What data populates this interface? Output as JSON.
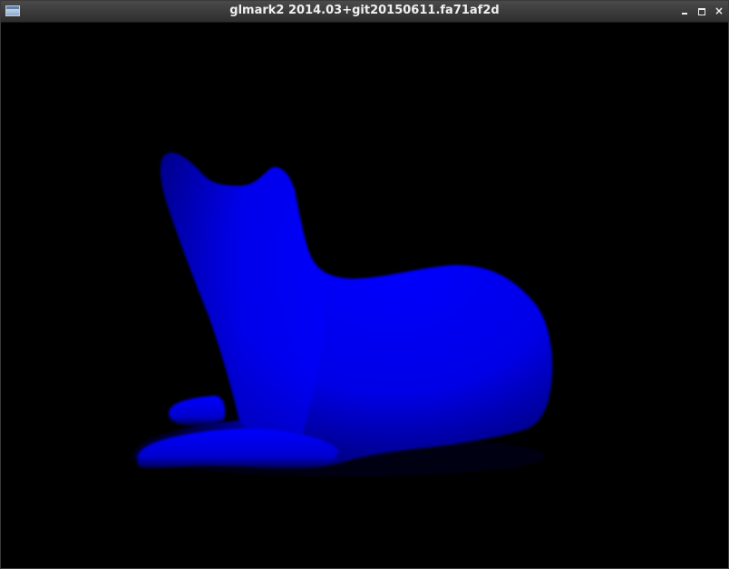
{
  "window": {
    "title": "glmark2 2014.03+git20150611.fa71af2d",
    "icon": "app-window-icon",
    "controls": {
      "minimize_icon": "minimize-icon",
      "maximize_icon": "maximize-icon",
      "close_icon": "close-icon",
      "close_glyph": "×"
    }
  },
  "scene": {
    "subject": "horse-model",
    "background_color": "#000000",
    "model_color": "#0000ff",
    "shadow_color": "#00002a"
  }
}
